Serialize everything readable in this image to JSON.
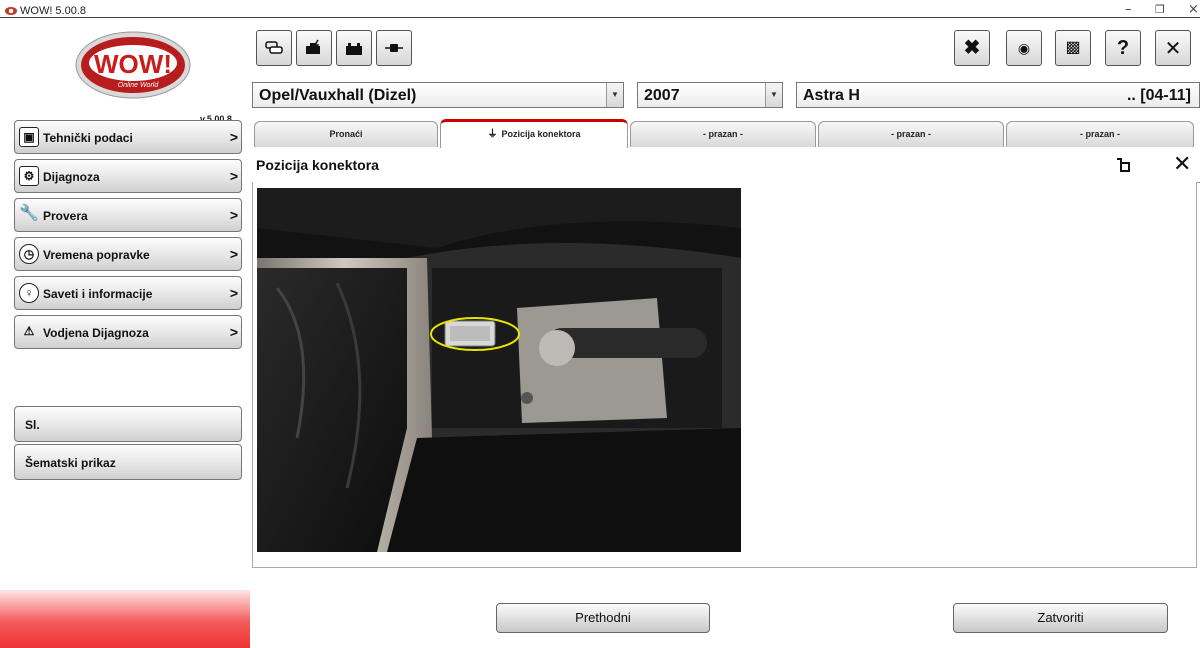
{
  "window": {
    "title": "WOW! 5.00.8",
    "controls": {
      "minimize": "–",
      "maximize": "❐",
      "close": "×"
    }
  },
  "sidebar": {
    "logo_text": "WOW!",
    "logo_subtext": "Online World",
    "version": "v.5.00.8",
    "items": [
      {
        "label": "Tehnički podaci",
        "icon": "info-screen-icon"
      },
      {
        "label": "Dijagnoza",
        "icon": "diagnosis-icon"
      },
      {
        "label": "Provera",
        "icon": "wrench-icon"
      },
      {
        "label": "Vremena popravke",
        "icon": "clock-icon"
      },
      {
        "label": "Saveti i informacije",
        "icon": "lightbulb-icon"
      },
      {
        "label": "Vodjena Dijagnoza",
        "icon": "guided-diagnosis-icon"
      }
    ],
    "extra": [
      {
        "label": "Sl."
      },
      {
        "label": "Šematski prikaz"
      }
    ],
    "chevron": ">"
  },
  "toolbar": {
    "left_icons": [
      "cars-icon",
      "engine-icon",
      "battery-icon",
      "connector-icon"
    ],
    "right_icons": [
      "tools-icon",
      "sensor-icon",
      "gift-icon",
      "help-icon",
      "close-icon"
    ],
    "help_glyph": "?",
    "close_glyph": "✕"
  },
  "selectors": {
    "make": "Opel/Vauxhall (Dizel)",
    "year": "2007",
    "model": "Astra H",
    "range": ".. [04-11]"
  },
  "tabs": [
    {
      "label": "Pronaći",
      "active": false
    },
    {
      "label": "Pozicija konektora",
      "active": true
    },
    {
      "label": "- prazan -",
      "active": false
    },
    {
      "label": "- prazan -",
      "active": false
    },
    {
      "label": "- prazan -",
      "active": false
    }
  ],
  "panel": {
    "title": "Pozicija konektora",
    "close_glyph": "✕"
  },
  "buttons": {
    "previous": "Prethodni",
    "close": "Zatvoriti"
  },
  "colors": {
    "accent_red": "#cc0000",
    "highlight_yellow": "#e6e600"
  }
}
